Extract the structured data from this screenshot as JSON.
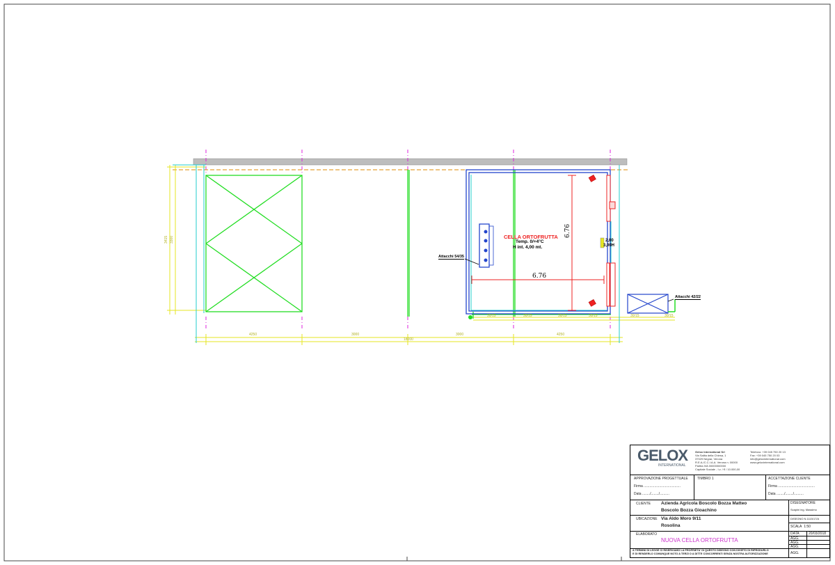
{
  "plan": {
    "cell_title": "CELLA ORTOFRUTTA",
    "cell_temp": "Temp. 0/+4°C",
    "cell_height": "H int. 4,00 mt.",
    "dim_width": "6.76",
    "dim_depth": "6.76",
    "door_width": "2,00",
    "door_height": "3,00H",
    "connection_left": "Attacchi 54/35",
    "connection_right": "Attacchi 42/22"
  },
  "titleblock": {
    "company_name": "Gelox International Srl",
    "company_lines": [
      "Via Salita della Chiesa, 1",
      "37029 Negrar, Verona",
      "R.E.A./C.C.I.A.A. Verona n. 00000",
      "Partita IVA 00000000000",
      "Capitale Sociale - I.v. / € / 10.000,00"
    ],
    "contact_lines": [
      "Telefono: +39 045 750 20 13",
      "Fax: +39 045 750 20 03",
      "info@geloxinternational.com",
      "www.geloxinternational.com"
    ],
    "logo_text": "GELOX",
    "logo_sub": "INTERNATIONAL",
    "approvazione": "APPROVAZIONE   PROGETTUALE",
    "timbro": "TIMBRO 1",
    "accettazione": "ACCETTAZIONE   CLIENTE",
    "firma_label": "Firma",
    "firma_dots": "......................................",
    "data_label": "Data",
    "data_dots": "......../......../..........",
    "cliente_label": "CLIENTE",
    "cliente_line1": "Azienda Agricola Boscolo Bozza Matteo",
    "cliente_line2": "Boscolo Bozza Gioachino",
    "disegnatore_label": "DISEGNATORE",
    "disegnatore_value": "Scapini ing. Massimo",
    "ubicazione_label": "UBICAZIONE",
    "ubicazione_line1": "Via Aldo Moro 9/11",
    "ubicazione_line2": "Rosolina",
    "disegno_label": "DISEGNO N.1115/17/A",
    "scala_label": "SCALA",
    "scala_value": "1:50",
    "elaborato_label": "ELABORATO",
    "data_label2": "DATA",
    "data_value": "20/03/2018",
    "agg1": "AGG.",
    "agg2": "AGG.",
    "agg3": "AGG.",
    "agg4": "AGG.",
    "elaborato_value": "NUOVA CELLA ORTOFRUTTA",
    "legal1": "A TERMINI DI LEGGE CI RISERVIAMO LA PROPRIETA' DI QUESTO DISEGNO CON DIVIETO DI RIPRODURLO",
    "legal2": "E DI RENDERLO COMUNQUE NOTO A TERZI O A DITTE CONCORRENTI SENZA NOSTRA AUTORIZZAZIONE"
  },
  "colors": {
    "green": "#22dd22",
    "yellow": "#e6e620",
    "cyan": "#22cccc",
    "magenta": "#dd22dd",
    "blue": "#2244cc",
    "red": "#ee2222",
    "wall_grey": "#bdbdbd",
    "elaborato_color": "#cc33cc"
  }
}
